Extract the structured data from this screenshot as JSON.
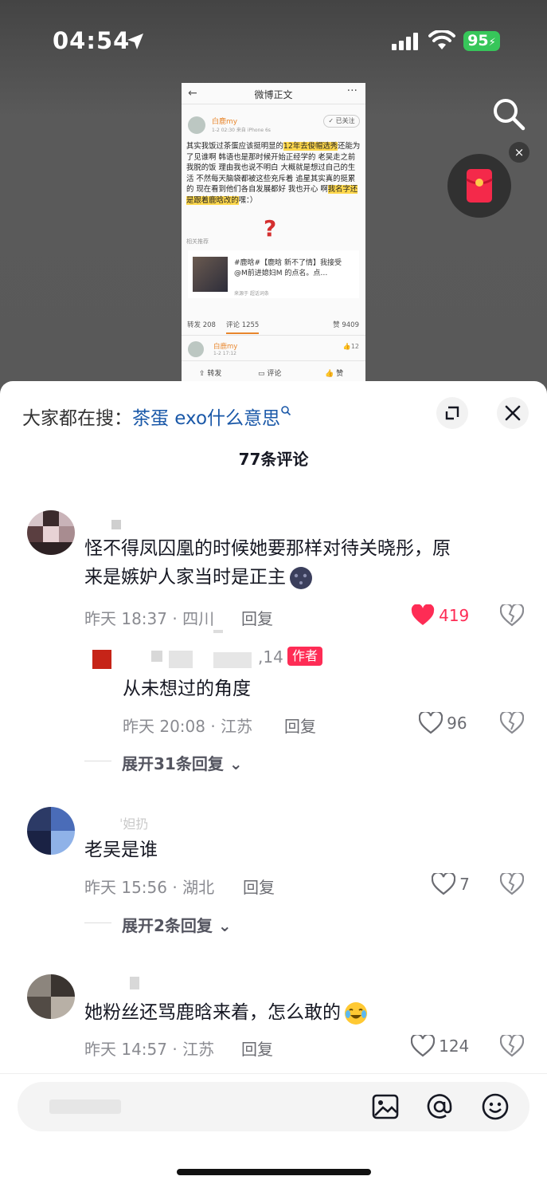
{
  "status_bar": {
    "time": "04:54",
    "battery": "95"
  },
  "video": {
    "screenshot": {
      "title": "微博正文",
      "user": "白鹿my",
      "meta": "1-2 02:30 来自 iPhone 6s",
      "follow": "✓ 已关注",
      "body_1": "其实我饭过茶蛋应该挺明显的",
      "body_hl1": "12年去俊帽选秀",
      "body_2": "还能为了见谁啊 韩语也是那时候开始正经学的 老吴走之前我脱的饭 理由我也说不明白 大概就是想过自己的生活 不然每天脑袋都被这些充斥着 追星其实真的挺累的 现在看到他们各自发展都好 我也开心 啊",
      "body_hl2": "我名字还是跟着鹿晗改的",
      "body_3": "嘿：）",
      "related": "相关推荐",
      "card_text": "#鹿晗#【鹿晗 新不了情】我接受@M前进媳妇M 的点名。点…",
      "card_meta": "来源于 超话词条",
      "repost": "转发 208",
      "comment_tab": "评论 1255",
      "likes": "赞 9409",
      "c2_name": "白鹿my",
      "c2_time": "1-2 17:12",
      "c2_like": "12",
      "bar_repost": "转发",
      "bar_comment": "评论",
      "bar_like": "赞"
    }
  },
  "sheet": {
    "hot_prefix": "大家都在搜：",
    "hot_keyword": "茶蛋 exo什么意思",
    "comment_count": "77条评论",
    "reply_label": "回复",
    "comments": [
      {
        "text_line1": "怪不得凤囚凰的时候她要那样对待关晓彤，原",
        "text_line2": "来是嫉妒人家当时是正主",
        "meta": "昨天 18:37 · 四川",
        "likes": "419",
        "sub": {
          "name_tail": ",14",
          "badge": "作者",
          "text": "从未想过的角度",
          "meta": "昨天 20:08 · 江苏",
          "likes": "96"
        },
        "expand": "展开31条回复"
      },
      {
        "name_fragment": "ˈ妲扔",
        "text": "老吴是谁",
        "meta": "昨天 15:56 · 湖北",
        "likes": "7",
        "expand": "展开2条回复"
      },
      {
        "text": "她粉丝还骂鹿晗来着，怎么敢的",
        "meta": "昨天 14:57 · 江苏",
        "likes": "124"
      }
    ]
  },
  "colors": {
    "accent_red": "#fe2c55",
    "link_blue": "#1a58a8",
    "battery_green": "#37c65a"
  }
}
